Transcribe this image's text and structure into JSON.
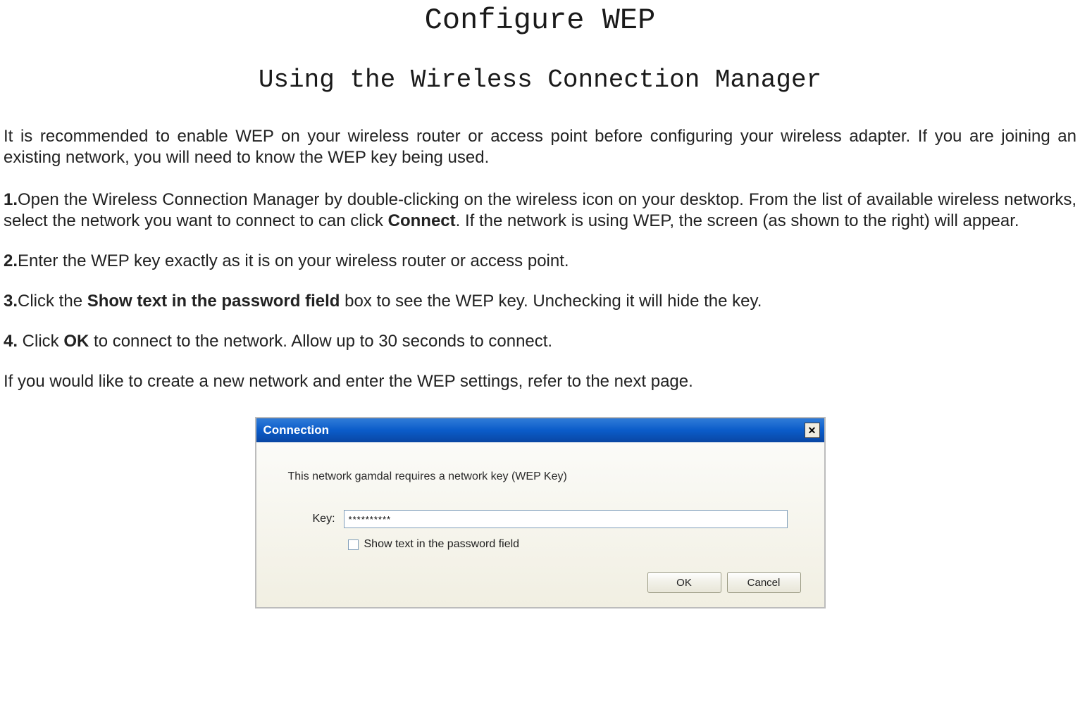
{
  "titles": {
    "main": "Configure WEP",
    "sub": "Using the  Wireless Connection Manager"
  },
  "intro": "It is recommended to enable WEP on your wireless router or access point before configuring your wireless adapter. If you are joining an existing network, you will need to know the WEP key being used.",
  "steps": {
    "s1_num": "1.",
    "s1_a": "Open the Wireless Connection Manager by double-clicking on the wireless icon on your desktop. From the list of available wireless networks, select the network you want to connect to can click ",
    "s1_bold": "Connect",
    "s1_b": ". If the network is using WEP, the screen (as shown to the right) will appear.",
    "s2_num": "2.",
    "s2_a": "Enter the WEP key exactly as it is on your wireless router or access point.",
    "s3_num": "3.",
    "s3_a": "Click the ",
    "s3_bold": "Show text in the password field",
    "s3_b": " box to see the WEP key. Unchecking it will hide the key.",
    "s4_num": "4.",
    "s4_a": " Click ",
    "s4_bold": "OK",
    "s4_b": " to connect to the network. Allow up to 30 seconds to connect."
  },
  "closing": "If you would like to create a new network and enter the WEP settings, refer to the next page.",
  "dialog": {
    "title": "Connection",
    "message": "This network gamdal requires a network key (WEP Key)",
    "key_label": "Key:",
    "key_value": "**********",
    "checkbox_label": "Show text in the password field",
    "checkbox_checked": false,
    "ok_label": "OK",
    "cancel_label": "Cancel"
  }
}
